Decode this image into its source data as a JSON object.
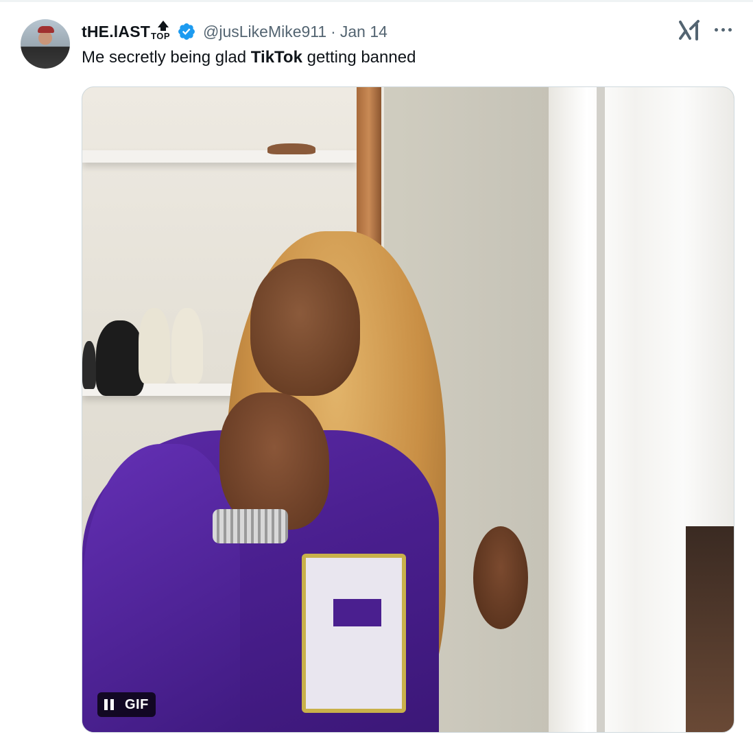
{
  "tweet": {
    "author": {
      "display_name": "tHE.lAST",
      "badge_text": "TOP",
      "handle": "@jusLikeMike911",
      "verified": true,
      "avatar_icon": "user-avatar-photo"
    },
    "separator": "·",
    "date": "Jan 14",
    "text_parts": [
      "Me secretly being glad ",
      "TikTok",
      " getting banned"
    ],
    "media": {
      "type": "gif",
      "badge_label": "GIF",
      "control_icon": "pause-icon"
    },
    "header_icons": [
      "grok-icon",
      "more-options-icon"
    ]
  },
  "colors": {
    "primary_text": "#0f1419",
    "secondary_text": "#536471",
    "verified_blue": "#1d9bf0",
    "border": "#cfd9de"
  }
}
